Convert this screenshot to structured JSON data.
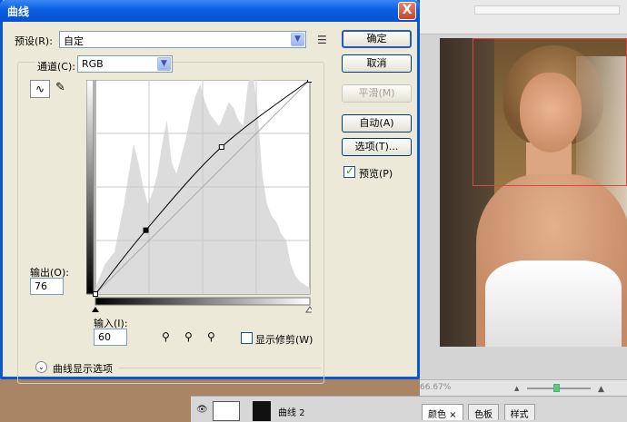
{
  "dialog": {
    "title": "曲线",
    "close_symbol": "X"
  },
  "preset": {
    "label": "预设(R):",
    "value": "自定"
  },
  "channel": {
    "label": "通道(C):",
    "value": "RGB"
  },
  "buttons": {
    "ok": "确定",
    "cancel": "取消",
    "smooth": "平滑(M)",
    "auto": "自动(A)",
    "options": "选项(T)..."
  },
  "preview": {
    "label": "预览(P)",
    "checked": true
  },
  "output": {
    "label": "输出(O):",
    "value": "76"
  },
  "input": {
    "label": "输入(I):",
    "value": "60"
  },
  "show_clipping": {
    "label": "显示修剪(W)",
    "checked": false
  },
  "curve_display_options": "曲线显示选项",
  "curve": {
    "points": [
      [
        0,
        0
      ],
      [
        60,
        76
      ],
      [
        150,
        175
      ],
      [
        255,
        255
      ]
    ],
    "selected_point": [
      60,
      76
    ]
  },
  "background": {
    "status_zoom": "66.67%",
    "layer_name": "曲线 2",
    "panel_tabs": [
      "颜色 ×",
      "色板",
      "样式"
    ]
  },
  "icons": {
    "menu": "list-menu-icon",
    "curve_tool": "curve-tool-icon",
    "pencil_tool": "pencil-icon",
    "black_point": "black-eyedropper-icon",
    "gray_point": "gray-eyedropper-icon",
    "white_point": "white-eyedropper-icon",
    "expander": "chevron-double-down-icon"
  }
}
